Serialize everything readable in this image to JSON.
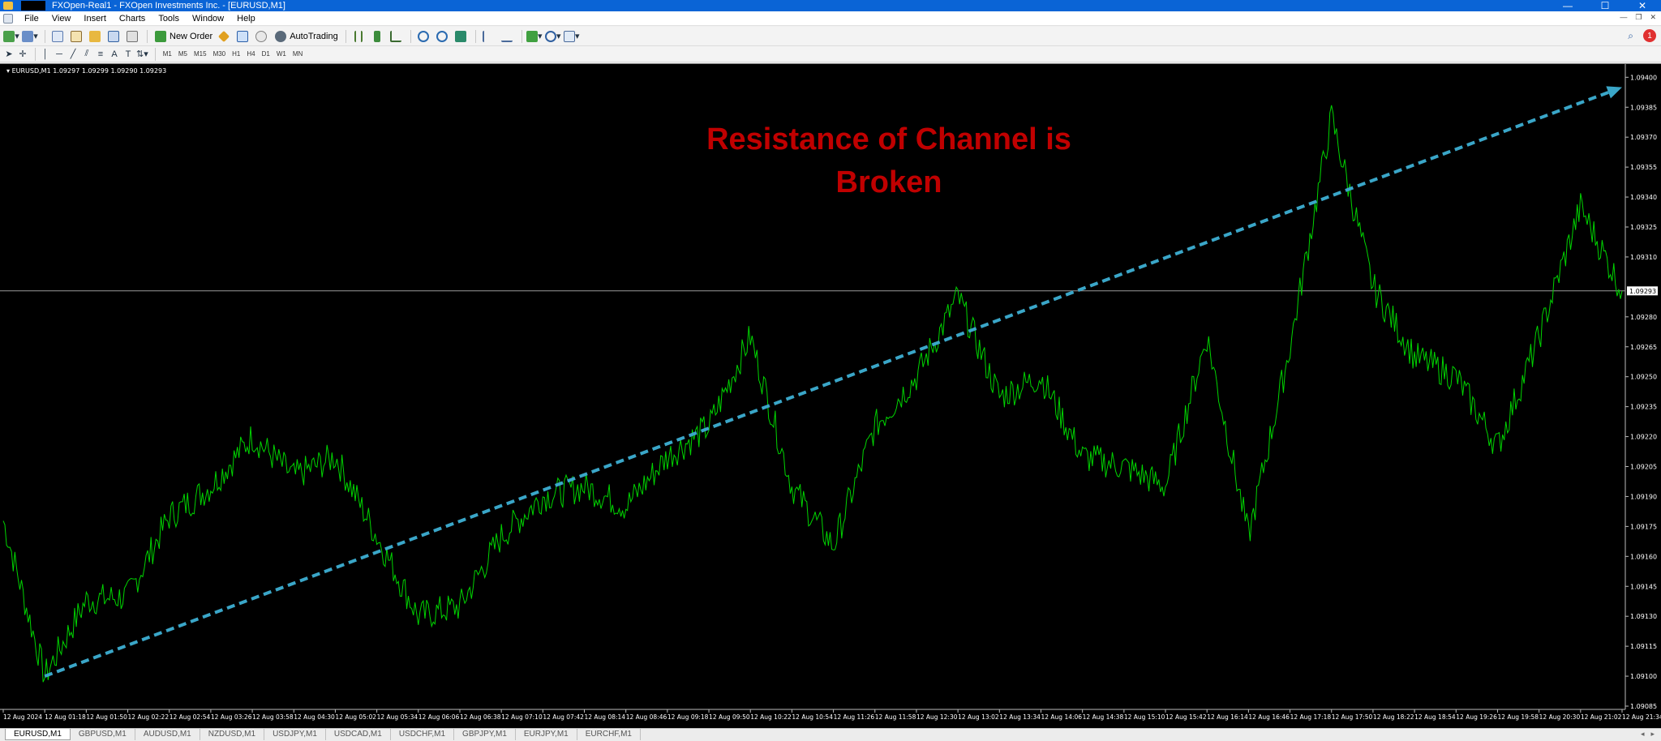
{
  "window": {
    "title": "FXOpen-Real1 - FXOpen Investments Inc. - [EURUSD,M1]",
    "controls": [
      "—",
      "☐",
      "✕"
    ]
  },
  "menu": {
    "items": [
      "File",
      "View",
      "Insert",
      "Charts",
      "Tools",
      "Window",
      "Help"
    ],
    "mdi_controls": [
      "—",
      "❐",
      "✕"
    ]
  },
  "toolbar": {
    "new_order": "New Order",
    "autotrading": "AutoTrading",
    "notification_count": "1",
    "timeframes": [
      "M1",
      "M5",
      "M15",
      "M30",
      "H1",
      "H4",
      "D1",
      "W1",
      "MN"
    ]
  },
  "chart": {
    "symbol_info": "EURUSD,M1  1.09297 1.09299 1.09290 1.09293",
    "annotation_line1": "Resistance of Channel is",
    "annotation_line2": "Broken",
    "current_price": "1.09293",
    "price_levels": [
      "1.09400",
      "1.09385",
      "1.09370",
      "1.09355",
      "1.09340",
      "1.09325",
      "1.09310",
      "1.09280",
      "1.09265",
      "1.09250",
      "1.09235",
      "1.09220",
      "1.09205",
      "1.09190",
      "1.09175",
      "1.09160",
      "1.09145",
      "1.09130",
      "1.09115",
      "1.09100",
      "1.09085"
    ],
    "time_labels": [
      "12 Aug 2024",
      "12 Aug 01:18",
      "12 Aug 01:50",
      "12 Aug 02:22",
      "12 Aug 02:54",
      "12 Aug 03:26",
      "12 Aug 03:58",
      "12 Aug 04:30",
      "12 Aug 05:02",
      "12 Aug 05:34",
      "12 Aug 06:06",
      "12 Aug 06:38",
      "12 Aug 07:10",
      "12 Aug 07:42",
      "12 Aug 08:14",
      "12 Aug 08:46",
      "12 Aug 09:18",
      "12 Aug 09:50",
      "12 Aug 10:22",
      "12 Aug 10:54",
      "12 Aug 11:26",
      "12 Aug 11:58",
      "12 Aug 12:30",
      "12 Aug 13:02",
      "12 Aug 13:34",
      "12 Aug 14:06",
      "12 Aug 14:38",
      "12 Aug 15:10",
      "12 Aug 15:42",
      "12 Aug 16:14",
      "12 Aug 16:46",
      "12 Aug 17:18",
      "12 Aug 17:50",
      "12 Aug 18:22",
      "12 Aug 18:54",
      "12 Aug 19:26",
      "12 Aug 19:58",
      "12 Aug 20:30",
      "12 Aug 21:02",
      "12 Aug 21:34"
    ],
    "colors": {
      "background": "#000000",
      "line": "#00d400",
      "trend": "#3aa6c8",
      "annotation": "#c00000",
      "text": "#ffffff"
    }
  },
  "chart_data": {
    "type": "line",
    "xlabel": "",
    "ylabel": "",
    "ylim": [
      1.09085,
      1.09405
    ],
    "x": [
      "12 Aug 2024",
      "12 Aug 01:18",
      "12 Aug 01:50",
      "12 Aug 02:22",
      "12 Aug 02:54",
      "12 Aug 03:26",
      "12 Aug 03:58",
      "12 Aug 04:30",
      "12 Aug 05:02",
      "12 Aug 05:34",
      "12 Aug 06:06",
      "12 Aug 06:38",
      "12 Aug 07:10",
      "12 Aug 07:42",
      "12 Aug 08:14",
      "12 Aug 08:46",
      "12 Aug 09:18",
      "12 Aug 09:50",
      "12 Aug 10:22",
      "12 Aug 10:54",
      "12 Aug 11:26",
      "12 Aug 11:58",
      "12 Aug 12:30",
      "12 Aug 13:02",
      "12 Aug 13:34",
      "12 Aug 14:06",
      "12 Aug 14:38",
      "12 Aug 15:10",
      "12 Aug 15:42",
      "12 Aug 16:14",
      "12 Aug 16:46",
      "12 Aug 17:18",
      "12 Aug 17:50",
      "12 Aug 18:22",
      "12 Aug 18:54",
      "12 Aug 19:26",
      "12 Aug 19:58",
      "12 Aug 20:30",
      "12 Aug 21:02",
      "12 Aug 21:34"
    ],
    "series": [
      {
        "values": [
          1.09178,
          1.091,
          1.09138,
          1.0914,
          1.0918,
          1.09195,
          1.0922,
          1.092,
          1.0921,
          1.0917,
          1.0913,
          1.09135,
          1.0917,
          1.0919,
          1.09195,
          1.09185,
          1.0921,
          1.09225,
          1.0927,
          1.09195,
          1.09165,
          1.09225,
          1.0925,
          1.0929,
          1.0924,
          1.0925,
          1.0921,
          1.09205,
          1.09195,
          1.0927,
          1.0917,
          1.09265,
          1.0938,
          1.09295,
          1.0926,
          1.0925,
          1.09215,
          1.0927,
          1.09335,
          1.09293
        ]
      }
    ],
    "trendline": {
      "from": [
        "12 Aug 01:18",
        1.091
      ],
      "to": [
        "12 Aug 21:34",
        1.09395
      ]
    },
    "current_price": 1.09293
  }
}
